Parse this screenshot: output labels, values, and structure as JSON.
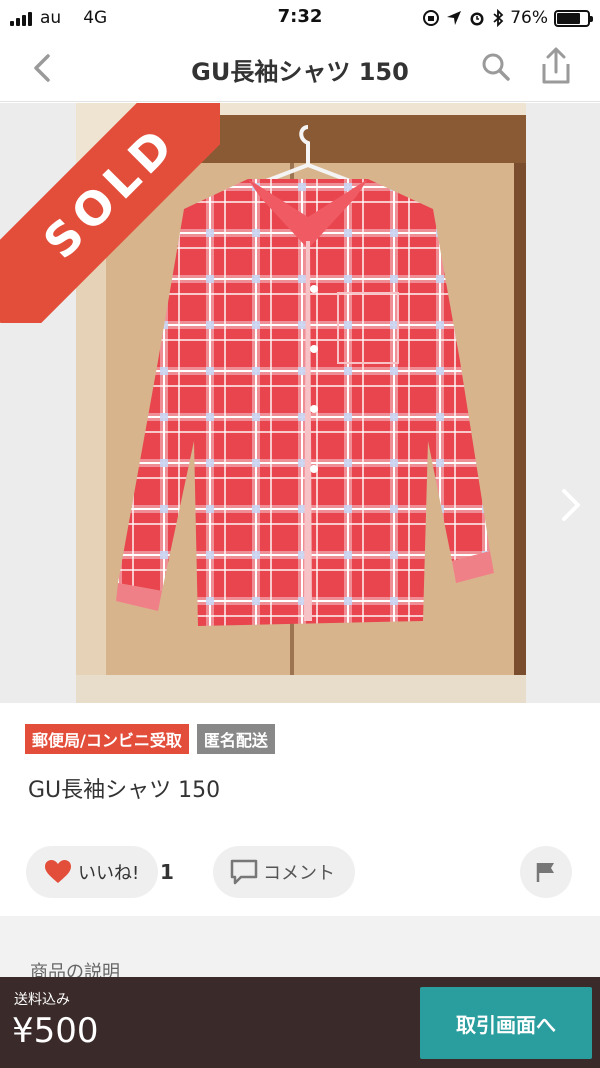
{
  "status_bar": {
    "carrier": "au",
    "network": "4G",
    "time": "7:32",
    "battery_percent": "76%",
    "battery_level": 0.76
  },
  "nav": {
    "title": "GU長袖シャツ 150",
    "back_icon": "chevron-left-icon",
    "search_icon": "search-icon",
    "share_icon": "share-icon"
  },
  "image": {
    "sold_label": "SOLD",
    "next_icon": "chevron-right-icon"
  },
  "item": {
    "tags": [
      {
        "label": "郵便局/コンビニ受取",
        "color": "#e34e3b"
      },
      {
        "label": "匿名配送",
        "color": "#888888"
      }
    ],
    "title": "GU長袖シャツ 150"
  },
  "actions": {
    "like_label": "いいね!",
    "like_count": "1",
    "comment_label": "コメント",
    "flag_icon": "flag-icon"
  },
  "description": {
    "label": "商品の説明"
  },
  "bottom_bar": {
    "shipping_label": "送料込み",
    "price": "¥500",
    "deal_button": "取引画面へ"
  },
  "colors": {
    "accent_red": "#e34e3b",
    "teal": "#2a9e9e",
    "bottom_bar_bg": "#3a2a2a"
  }
}
